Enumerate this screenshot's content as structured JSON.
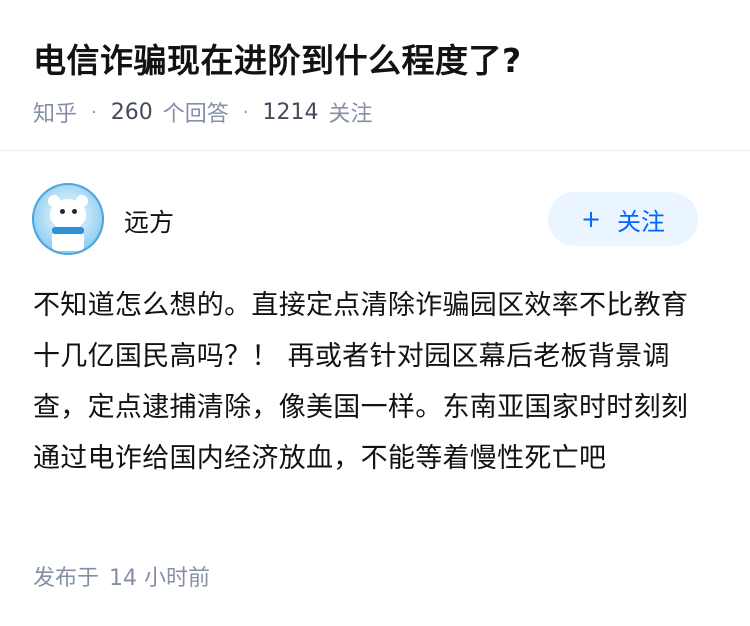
{
  "question": {
    "title": "电信诈骗现在进阶到什么程度了?",
    "source": "知乎",
    "separator": "·",
    "answers_count": "260",
    "answers_label": "个回答",
    "followers_count": "1214",
    "followers_label": "关注"
  },
  "author": {
    "name": "远方",
    "avatar_icon": "polar-bear-avatar-icon"
  },
  "follow_button": {
    "plus": "+",
    "label": "关注",
    "bg_color": "#ebf5ff",
    "text_color": "#0066ff"
  },
  "answer": {
    "content": "不知道怎么想的。直接定点清除诈骗园区效率不比教育十几亿国民高吗？！ 再或者针对园区幕后老板背景调查，定点逮捕清除，像美国一样。东南亚国家时时刻刻通过电诈给国内经济放血，不能等着慢性死亡吧",
    "published_prefix": "发布于",
    "published_time": "14 小时前"
  },
  "colors": {
    "meta_gray": "#8590a6",
    "title_black": "#121212",
    "divider": "#ebebeb"
  }
}
